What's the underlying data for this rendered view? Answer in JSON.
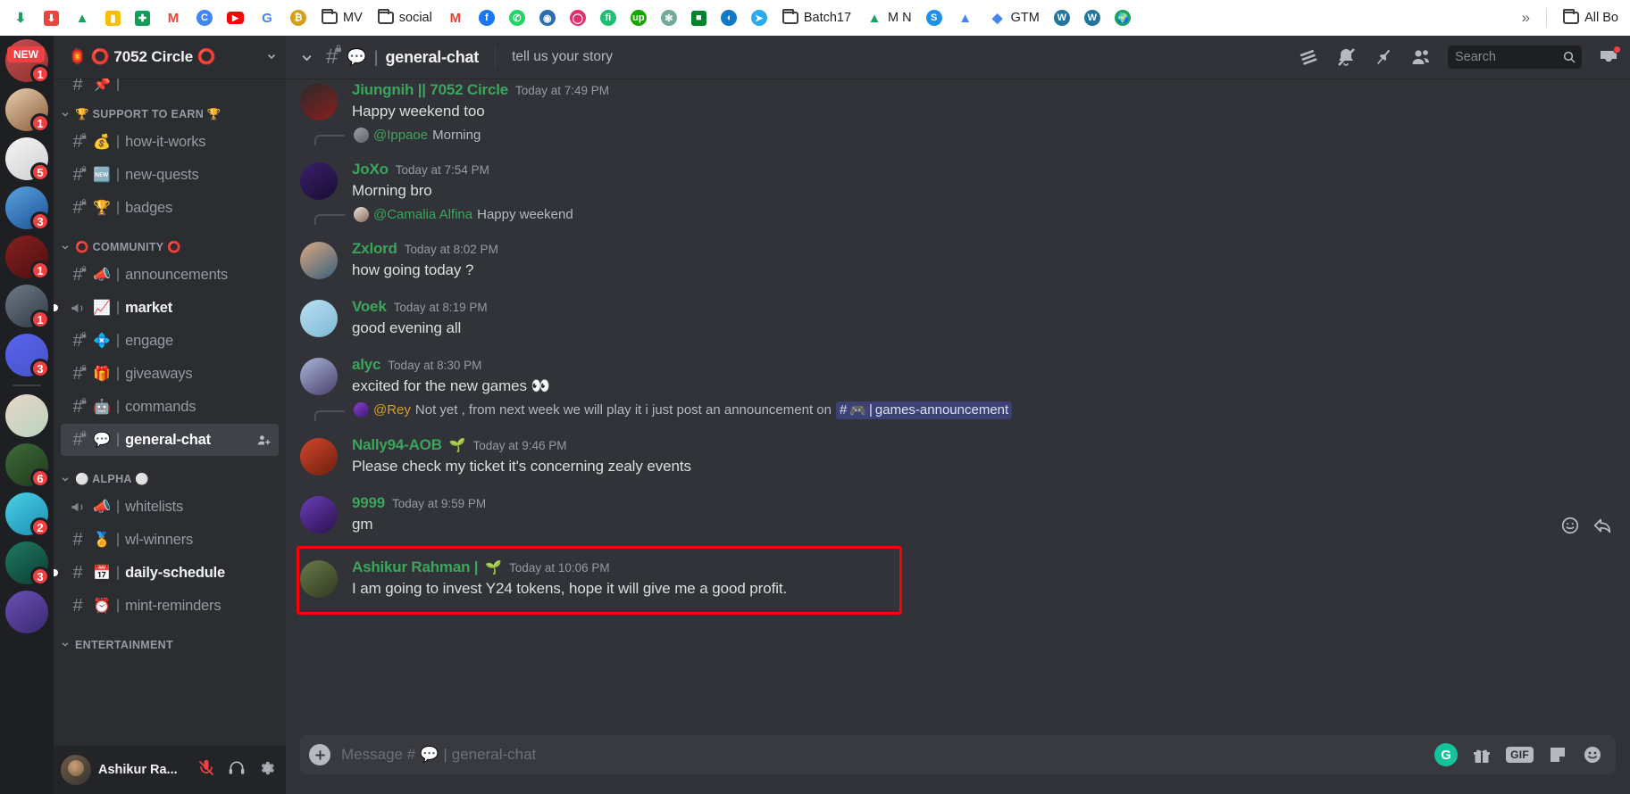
{
  "browser": {
    "bookmarks": [
      {
        "label": "",
        "icon": "download-green-icon",
        "color": "#1aa260",
        "glyph": "⬇"
      },
      {
        "label": "",
        "icon": "idm-download-icon",
        "color": "#e8453c",
        "glyph": "⬇"
      },
      {
        "label": "",
        "icon": "google-drive-icon",
        "color": "#1aa260",
        "glyph": "▲"
      },
      {
        "label": "",
        "icon": "keep-notes-icon",
        "color": "#fbbc04",
        "glyph": "▮"
      },
      {
        "label": "",
        "icon": "sheets-icon",
        "color": "#0f9d58",
        "glyph": "✚"
      },
      {
        "label": "",
        "icon": "gmail-icon",
        "color": "#ea4335",
        "glyph": "M"
      },
      {
        "label": "",
        "icon": "chrome-profile-icon",
        "color": "#4285f4",
        "glyph": "C"
      },
      {
        "label": "",
        "icon": "youtube-icon",
        "color": "#ff0000",
        "glyph": "▶"
      },
      {
        "label": "",
        "icon": "google-icon",
        "color": "#4285f4",
        "glyph": "G"
      },
      {
        "label": "",
        "icon": "bitcoin-icon",
        "color": "#d4a017",
        "glyph": "₿"
      },
      {
        "label": "MV",
        "icon": "folder-icon",
        "color": "#3c4043",
        "glyph": "folder"
      },
      {
        "label": "social",
        "icon": "folder-icon",
        "color": "#3c4043",
        "glyph": "folder"
      },
      {
        "label": "",
        "icon": "gmail-icon",
        "color": "#ea4335",
        "glyph": "M"
      },
      {
        "label": "",
        "icon": "facebook-icon",
        "color": "#1877f2",
        "glyph": "f"
      },
      {
        "label": "",
        "icon": "whatsapp-icon",
        "color": "#25d366",
        "glyph": "✆"
      },
      {
        "label": "",
        "icon": "globe-avatar-icon",
        "color": "#2b6cb0",
        "glyph": "◉"
      },
      {
        "label": "",
        "icon": "instagram-icon",
        "color": "#e1306c",
        "glyph": "◯"
      },
      {
        "label": "",
        "icon": "fiverr-icon",
        "color": "#1dbf73",
        "glyph": "fi"
      },
      {
        "label": "",
        "icon": "upwork-icon",
        "color": "#14a800",
        "glyph": "up"
      },
      {
        "label": "",
        "icon": "openai-icon",
        "color": "#74aa9c",
        "glyph": "✻"
      },
      {
        "label": "",
        "icon": "google-meet-icon",
        "color": "#00832d",
        "glyph": "■"
      },
      {
        "label": "",
        "icon": "edge-icon",
        "color": "#0f7ac7",
        "glyph": "◖"
      },
      {
        "label": "",
        "icon": "telegram-icon",
        "color": "#2aabee",
        "glyph": "➤"
      },
      {
        "label": "Batch17",
        "icon": "folder-icon",
        "color": "#3c4043",
        "glyph": "folder"
      },
      {
        "label": "M N",
        "icon": "google-drive-icon",
        "color": "#1aa260",
        "glyph": "▲"
      },
      {
        "label": "",
        "icon": "semrush-icon",
        "color": "#1f8feb",
        "glyph": "S"
      },
      {
        "label": "",
        "icon": "google-ads-icon",
        "color": "#4285f4",
        "glyph": "▲"
      },
      {
        "label": "GTM",
        "icon": "google-tag-manager-icon",
        "color": "#4285f4",
        "glyph": "◆"
      },
      {
        "label": "",
        "icon": "wordpress-icon",
        "color": "#21759b",
        "glyph": "W"
      },
      {
        "label": "",
        "icon": "wordpress-icon",
        "color": "#21759b",
        "glyph": "W"
      },
      {
        "label": "",
        "icon": "earth-icon",
        "color": "#1aa260",
        "glyph": "🌍"
      }
    ],
    "overflow_label": "»",
    "all_bookmarks_label": "All Bo"
  },
  "rail": {
    "new_badge": "NEW",
    "servers": [
      {
        "name": "server-new-top",
        "badge": "1",
        "showNew": true,
        "c1": "#c94f4f",
        "c2": "#8a3131"
      },
      {
        "name": "server-anime-girl",
        "badge": "1",
        "c1": "#e8cfae",
        "c2": "#8a5b3a"
      },
      {
        "name": "server-eye-art",
        "badge": "5",
        "c1": "#f5f5f5",
        "c2": "#cfcfcf"
      },
      {
        "name": "server-blue-triangle",
        "badge": "3",
        "c1": "#5aa4e0",
        "c2": "#1c4f95"
      },
      {
        "name": "server-red-circle-photo",
        "badge": "1",
        "c1": "#8a2020",
        "c2": "#4a1010"
      },
      {
        "name": "server-car-selfie",
        "badge": "1",
        "c1": "#6e7a86",
        "c2": "#2f3a44"
      },
      {
        "name": "server-discord-default",
        "badge": "3",
        "c1": "#5865f2",
        "c2": "#4752c4"
      },
      {
        "name": "server-deadtaff",
        "badge": "",
        "c1": "#e9d5c6",
        "c2": "#b9d4c0"
      },
      {
        "name": "server-4twenty-dao",
        "badge": "6",
        "c1": "#3f6b3a",
        "c2": "#1f3a1c"
      },
      {
        "name": "server-treasure-chest",
        "badge": "2",
        "c1": "#4bd0e8",
        "c2": "#1b8fb0"
      },
      {
        "name": "server-gg-logo",
        "badge": "3",
        "c1": "#1f7a63",
        "c2": "#0d3d32"
      },
      {
        "name": "server-purple-last",
        "badge": "",
        "c1": "#6a4fb5",
        "c2": "#3a2a70"
      }
    ]
  },
  "sidebar": {
    "server_name": "🏮 ⭕ 7052 Circle ⭕",
    "chevron": "∨",
    "categories": [
      {
        "name": "🏆 SUPPORT TO EARN 🏆",
        "label": "SUPPORT TO EARN",
        "emoji_left": "🏆",
        "emoji_right": "🏆",
        "channels": [
          {
            "emoji": "💰",
            "name": "how-it-works",
            "type": "text",
            "locked": true,
            "state": "read"
          },
          {
            "emoji": "🆕",
            "name": "new-quests",
            "type": "text",
            "locked": true,
            "state": "read"
          },
          {
            "emoji": "🏆",
            "name": "badges",
            "type": "text",
            "locked": true,
            "state": "read"
          }
        ]
      },
      {
        "name": "⭕ COMMUNITY ⭕",
        "label": "COMMUNITY",
        "emoji_left": "⭕",
        "emoji_right": "⭕",
        "channels": [
          {
            "emoji": "📣",
            "name": "announcements",
            "type": "text",
            "locked": true,
            "state": "read"
          },
          {
            "emoji": "📈",
            "name": "market",
            "type": "announcement",
            "locked": false,
            "state": "unread"
          },
          {
            "emoji": "💠",
            "name": "engage",
            "type": "text",
            "locked": true,
            "state": "read"
          },
          {
            "emoji": "🎁",
            "name": "giveaways",
            "type": "text",
            "locked": true,
            "state": "read"
          },
          {
            "emoji": "🤖",
            "name": "commands",
            "type": "text",
            "locked": true,
            "state": "read"
          },
          {
            "emoji": "💬",
            "name": "general-chat",
            "type": "text",
            "locked": true,
            "state": "active"
          }
        ]
      },
      {
        "name": "⚪ ALPHA ⚪",
        "label": "ALPHA",
        "emoji_left": "⚪",
        "emoji_right": "⚪",
        "channels": [
          {
            "emoji": "📣",
            "name": "whitelists",
            "type": "announcement",
            "locked": false,
            "state": "read"
          },
          {
            "emoji": "🏅",
            "name": "wl-winners",
            "type": "text",
            "locked": false,
            "state": "read"
          },
          {
            "emoji": "📅",
            "name": "daily-schedule",
            "type": "text",
            "locked": false,
            "state": "unread"
          },
          {
            "emoji": "⏰",
            "name": "mint-reminders",
            "type": "text",
            "locked": false,
            "state": "read"
          }
        ]
      },
      {
        "name": "ENTERTAINMENT",
        "label": "ENTERTAINMENT",
        "emoji_left": "",
        "emoji_right": "🎮",
        "channels": []
      }
    ],
    "add_member_icon": "add-member-icon"
  },
  "user_panel": {
    "name": "Ashikur Ra...",
    "mic_icon": "mic-muted-icon",
    "headset_icon": "headset-icon",
    "settings_icon": "gear-icon"
  },
  "chat_header": {
    "collapse_icon": "chevron-down-icon",
    "hash_icon": "hash-locked-icon",
    "channel_emoji": "💬",
    "pipe": "|",
    "channel_name": "general-chat",
    "topic": "tell us your story",
    "icons": [
      {
        "name": "threads-icon",
        "glyph": "threads"
      },
      {
        "name": "bell-muted-icon",
        "glyph": "bell-muted"
      },
      {
        "name": "pin-icon",
        "glyph": "pin"
      },
      {
        "name": "members-icon",
        "glyph": "members"
      }
    ],
    "search_placeholder": "Search",
    "search_icon": "search-icon",
    "inbox_icon": "inbox-icon"
  },
  "messages": [
    {
      "id": "m1",
      "type": "message",
      "author": "Jiungnih || 7052 Circle",
      "author_badge": "",
      "timestamp": "Today at 7:49 PM",
      "text": "Happy weekend too",
      "avatar": {
        "c1": "#2a2a2a",
        "c2": "#8a1f1f"
      }
    },
    {
      "id": "r1",
      "type": "reply",
      "ref_user": "@Ippaoe",
      "ref_color": "green",
      "ref_text": "Morning",
      "avatar": {
        "c1": "#9aa0a6",
        "c2": "#5f6368"
      }
    },
    {
      "id": "m2",
      "type": "message",
      "author": "JoXo",
      "author_badge": "",
      "timestamp": "Today at 7:54 PM",
      "text": "Morning bro",
      "avatar": {
        "c1": "#3a1f6b",
        "c2": "#1a0d33"
      }
    },
    {
      "id": "r2",
      "type": "reply",
      "ref_user": "@Camalia Alfina",
      "ref_color": "green",
      "ref_text": "Happy weekend",
      "avatar": {
        "c1": "#e7e2dc",
        "c2": "#8a6a55"
      }
    },
    {
      "id": "m3",
      "type": "message",
      "author": "Zxlord",
      "author_badge": "",
      "timestamp": "Today at 8:02 PM",
      "text": "how going today ?",
      "avatar": {
        "c1": "#d9a882",
        "c2": "#3a5f7a"
      }
    },
    {
      "id": "m4",
      "type": "message",
      "author": "Voek",
      "author_badge": "",
      "timestamp": "Today at 8:19 PM",
      "text": "good evening all",
      "avatar": {
        "c1": "#b9dff0",
        "c2": "#7fb8d8"
      }
    },
    {
      "id": "m5",
      "type": "message",
      "author": "alyc",
      "author_badge": "",
      "timestamp": "Today at 8:30 PM",
      "text": "excited for the new games 👀",
      "avatar": {
        "c1": "#a8b6d8",
        "c2": "#4a3f6b"
      }
    },
    {
      "id": "r3",
      "type": "reply",
      "ref_user": "@Rey",
      "ref_color": "gold",
      "ref_text": "Not yet , from next week we will play it i just post an announcement on",
      "ref_mention": {
        "hash": "#",
        "emoji": "🎮",
        "pipe": "|",
        "name": "games-announcement"
      },
      "avatar": {
        "c1": "#8b3fd6",
        "c2": "#3d1a6b"
      }
    },
    {
      "id": "m6",
      "type": "message",
      "author": "Nally94-AOB",
      "author_badge": "🌱",
      "timestamp": "Today at 9:46 PM",
      "text": "Please check my ticket it's concerning zealy events",
      "avatar": {
        "c1": "#d4452a",
        "c2": "#6b1f10"
      }
    },
    {
      "id": "m7",
      "type": "message",
      "author": "9999",
      "author_badge": "",
      "timestamp": "Today at 9:59 PM",
      "text": "gm",
      "avatar": {
        "c1": "#6a3fb5",
        "c2": "#2a1050"
      }
    },
    {
      "id": "m8",
      "type": "message",
      "author": "Ashikur Rahman |",
      "author_badge": "🌱",
      "timestamp": "Today at 10:06 PM",
      "text": "I am going to invest Y24 tokens, hope it will give me a good profit.",
      "avatar": {
        "c1": "#6b7a4a",
        "c2": "#2f3a20"
      },
      "highlighted": true
    }
  ],
  "hover_actions": {
    "add_reaction_icon": "emoji-reaction-icon",
    "reply_icon": "reply-arrow-icon"
  },
  "composer": {
    "plus_label": "+",
    "placeholder_prefix": "Message #",
    "placeholder_emoji": "💬",
    "placeholder_pipe": "|",
    "placeholder_channel": "general-chat",
    "grammarly_icon": "grammarly-icon",
    "gift_icon": "gift-icon",
    "gif_label": "GIF",
    "sticker_icon": "sticker-icon",
    "emoji_icon": "emoji-icon"
  },
  "colors": {
    "username_green": "#3ba55c",
    "mention_gold": "#d5a021",
    "highlight_red": "#ff0000",
    "accent_blurple": "#5865f2",
    "badge_red": "#f23f42"
  }
}
